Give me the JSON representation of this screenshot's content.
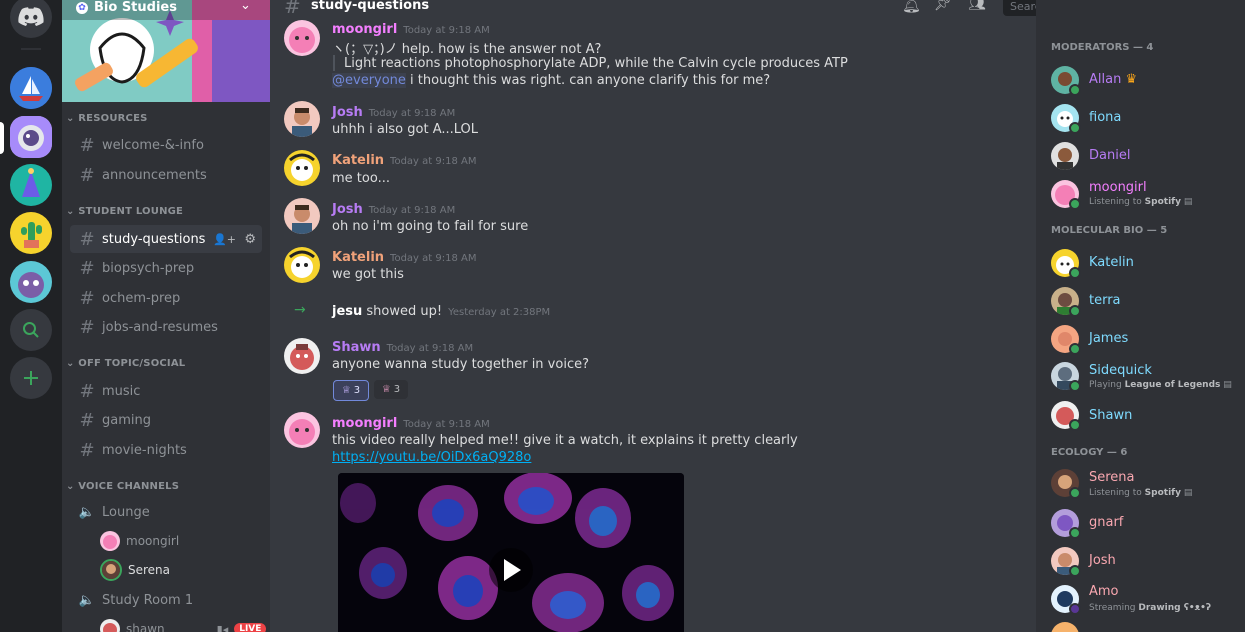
{
  "server": {
    "name": "Bio Studies"
  },
  "categories": [
    {
      "label": "RESOURCES",
      "channels": [
        "welcome-&-info",
        "announcements"
      ]
    },
    {
      "label": "STUDENT LOUNGE",
      "channels": [
        "study-questions",
        "biopsych-prep",
        "ochem-prep",
        "jobs-and-resumes"
      ]
    },
    {
      "label": "OFF TOPIC/SOCIAL",
      "channels": [
        "music",
        "gaming",
        "movie-nights"
      ]
    },
    {
      "label": "VOICE CHANNELS",
      "voice": [
        {
          "name": "Lounge",
          "users": [
            "moongirl",
            "Serena"
          ]
        },
        {
          "name": "Study Room 1",
          "users": [
            "shawn"
          ]
        }
      ]
    }
  ],
  "live_badge": "LIVE",
  "header": {
    "channel": "study-questions",
    "search_placeholder": "Search"
  },
  "messages": [
    {
      "user": "moongirl",
      "time": "Today at 9:18 AM",
      "color": "#f47fff",
      "lines": [
        "ヽ(；▽；)ノ help. how is the answer not A?",
        "Light reactions photophosphorylate ADP, while the Calvin cycle produces ATP"
      ],
      "mention": "@everyone",
      "mention_rest": " i thought this was right. can anyone clarify this for me?"
    },
    {
      "user": "Josh",
      "time": "Today at 9:18 AM",
      "color": "#b77cf4",
      "text": "uhhh i also got A...LOL"
    },
    {
      "user": "Katelin",
      "time": "Today at 9:18 AM",
      "color": "#f0a27a",
      "text": "me too..."
    },
    {
      "user": "Josh",
      "time": "Today at 9:18 AM",
      "color": "#b77cf4",
      "text": "oh no i'm going to fail for sure"
    },
    {
      "user": "Katelin",
      "time": "Today at 9:18 AM",
      "color": "#f0a27a",
      "text": "we got this"
    },
    {
      "system": true,
      "user": "jesu",
      "text": "showed up!",
      "time": "Yesterday at 2:38PM"
    },
    {
      "user": "Shawn",
      "time": "Today at 9:18 AM",
      "color": "#b77cf4",
      "text": "anyone wanna study together in voice?",
      "reactions": [
        3,
        3
      ]
    },
    {
      "user": "moongirl",
      "time": "Today at 9:18 AM",
      "color": "#f47fff",
      "text": "this video really helped me!! give it a watch, it explains it pretty clearly",
      "link": "https://youtu.be/OiDx6aQ928o"
    }
  ],
  "members": {
    "groups": [
      {
        "label": "MODERATORS — 4",
        "users": [
          {
            "name": "Allan",
            "color": "#b77cf4",
            "crown": true
          },
          {
            "name": "fiona",
            "color": "#7fdbff"
          },
          {
            "name": "Daniel",
            "color": "#b77cf4"
          },
          {
            "name": "moongirl",
            "color": "#f47fff",
            "activity": "Listening to ",
            "activity_bold": "Spotify"
          }
        ]
      },
      {
        "label": "MOLECULAR BIO — 5",
        "users": [
          {
            "name": "Katelin",
            "color": "#7fdbff"
          },
          {
            "name": "terra",
            "color": "#7fdbff"
          },
          {
            "name": "James",
            "color": "#7fdbff"
          },
          {
            "name": "Sidequick",
            "color": "#7fdbff",
            "activity": "Playing ",
            "activity_bold": "League of Legends"
          },
          {
            "name": "Shawn",
            "color": "#7fdbff"
          }
        ]
      },
      {
        "label": "ECOLOGY — 6",
        "users": [
          {
            "name": "Serena",
            "color": "#f9a7b0",
            "activity": "Listening to ",
            "activity_bold": "Spotify"
          },
          {
            "name": "gnarf",
            "color": "#f9a7b0"
          },
          {
            "name": "Josh",
            "color": "#f9a7b0"
          },
          {
            "name": "Amo",
            "color": "#f9a7b0",
            "activity": "Streaming ",
            "activity_bold": "Drawing ʕ•ᴥ•ʔ"
          }
        ]
      }
    ]
  }
}
